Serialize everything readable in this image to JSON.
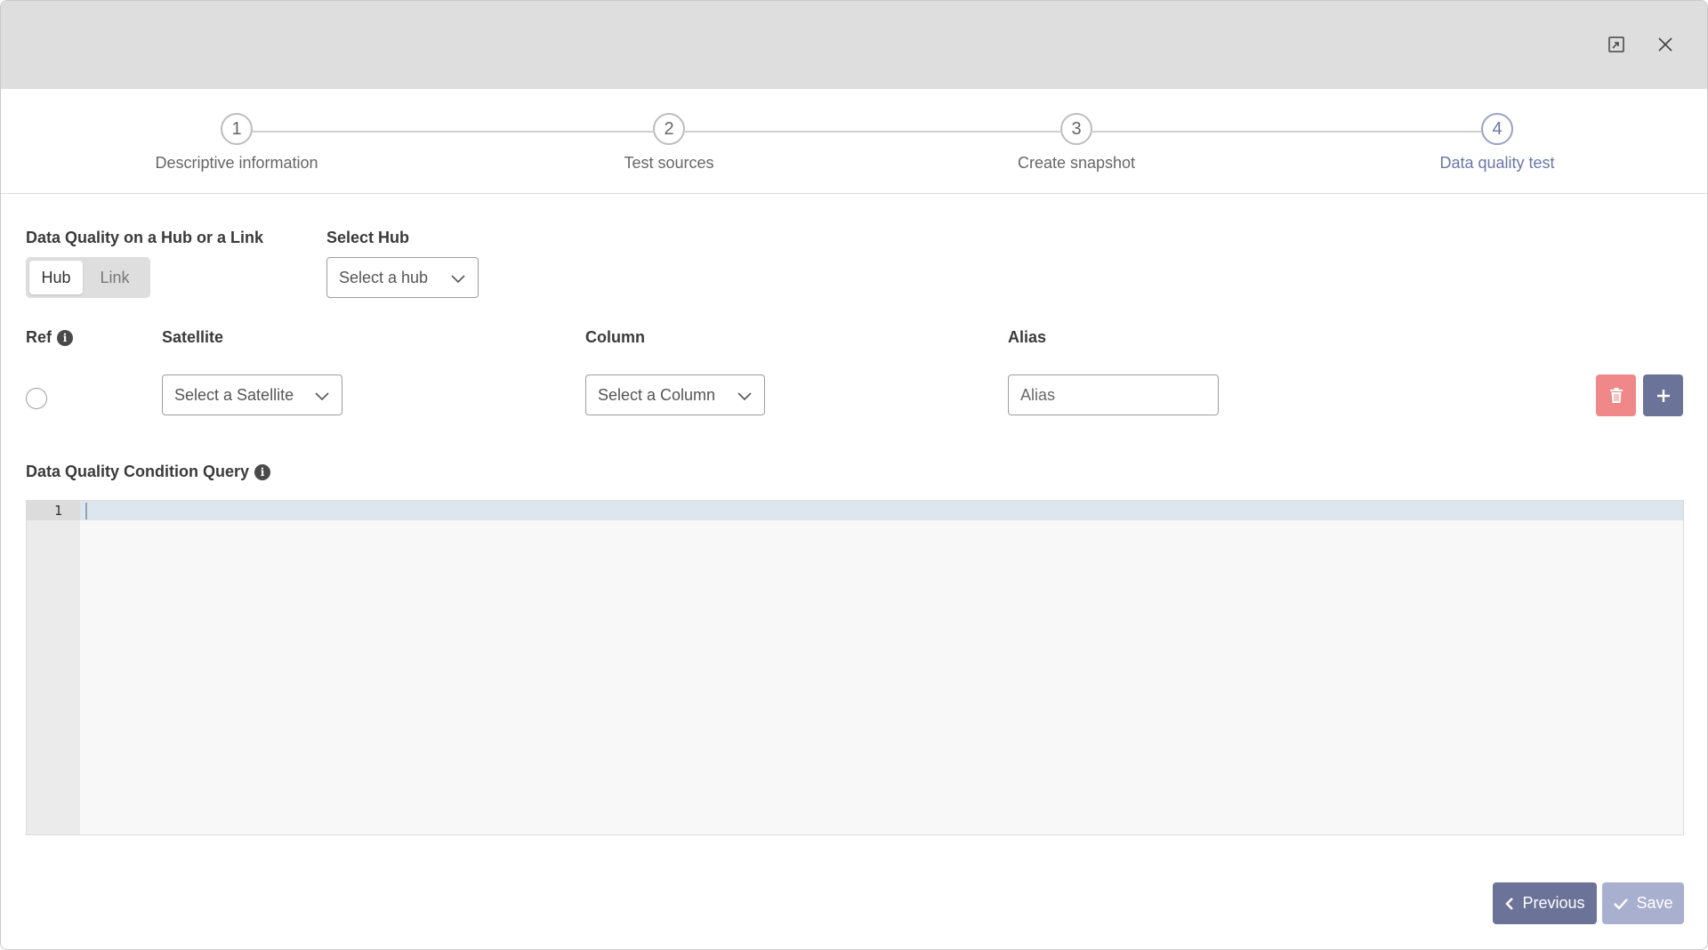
{
  "window": {
    "expand_icon": "expand-icon",
    "close_icon": "close-icon"
  },
  "stepper": {
    "steps": [
      {
        "number": "1",
        "label": "Descriptive information",
        "active": false
      },
      {
        "number": "2",
        "label": "Test sources",
        "active": false
      },
      {
        "number": "3",
        "label": "Create snapshot",
        "active": false
      },
      {
        "number": "4",
        "label": "Data quality test",
        "active": true
      }
    ]
  },
  "form": {
    "hub_or_link_label": "Data Quality on a Hub or a Link",
    "toggle": {
      "hub": "Hub",
      "link": "Link",
      "selected": "Hub"
    },
    "select_hub_label": "Select Hub",
    "select_hub_placeholder": "Select a hub",
    "ref_label": "Ref",
    "satellite_label": "Satellite",
    "satellite_placeholder": "Select a Satellite",
    "column_label": "Column",
    "column_placeholder": "Select a Column",
    "alias_label": "Alias",
    "alias_placeholder": "Alias",
    "query_label": "Data Quality Condition Query",
    "editor": {
      "line_number": "1",
      "content": ""
    }
  },
  "footer": {
    "previous_label": "Previous",
    "save_label": "Save"
  },
  "colors": {
    "accent": "#6b7399",
    "accent_disabled": "#a9b0cf",
    "danger": "#f0888a",
    "header_bg": "#dedede",
    "active_step": "#6b76a8"
  }
}
